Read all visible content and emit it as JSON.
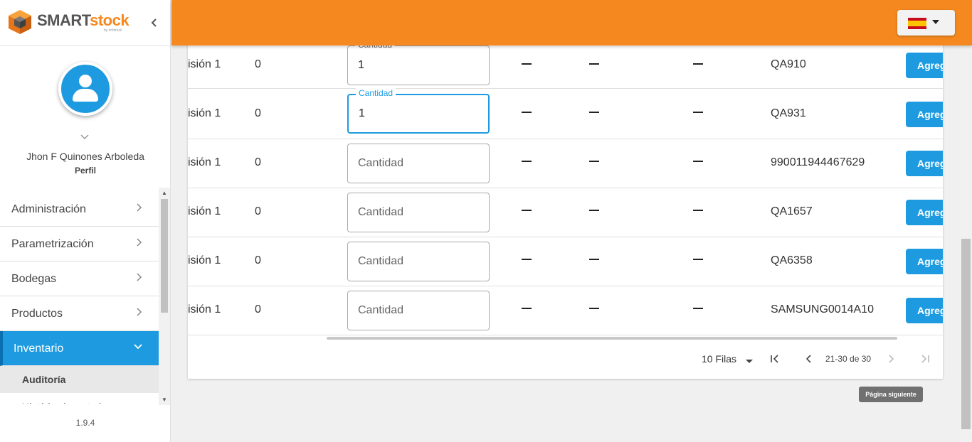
{
  "app": {
    "logo_smart": "SMART",
    "logo_stock": "stock",
    "logo_sub": "by infotrack",
    "brand_color": "#f5891f",
    "accent_color": "#1e9be0"
  },
  "profile": {
    "name": "Jhon F Quinones Arboleda",
    "link": "Perfil"
  },
  "sidebar": {
    "items": [
      {
        "label": "Administración"
      },
      {
        "label": "Parametrización"
      },
      {
        "label": "Bodegas"
      },
      {
        "label": "Productos"
      },
      {
        "label": "Inventario"
      }
    ],
    "sub_items": [
      {
        "label": "Auditoría"
      },
      {
        "label": "Histórico inventario"
      }
    ],
    "version": "1.9.4"
  },
  "header": {
    "language": "es"
  },
  "table": {
    "quantity_label": "Cantidad",
    "add_label": "Agregar",
    "dash": "—",
    "rows": [
      {
        "bodega": "isión 1",
        "stock": "0",
        "cantidad": "1",
        "serial": "QA910"
      },
      {
        "bodega": "isión 1",
        "stock": "0",
        "cantidad": "1",
        "serial": "QA931"
      },
      {
        "bodega": "isión 1",
        "stock": "0",
        "cantidad": "",
        "serial": "990011944467629"
      },
      {
        "bodega": "isión 1",
        "stock": "0",
        "cantidad": "",
        "serial": "QA1657"
      },
      {
        "bodega": "isión 1",
        "stock": "0",
        "cantidad": "",
        "serial": "QA6358"
      },
      {
        "bodega": "isión 1",
        "stock": "0",
        "cantidad": "",
        "serial": "SAMSUNG0014A10"
      }
    ]
  },
  "pager": {
    "rows_per_page": "10 Filas",
    "range": "21-30 de 30",
    "tooltip": "Página siguiente"
  }
}
